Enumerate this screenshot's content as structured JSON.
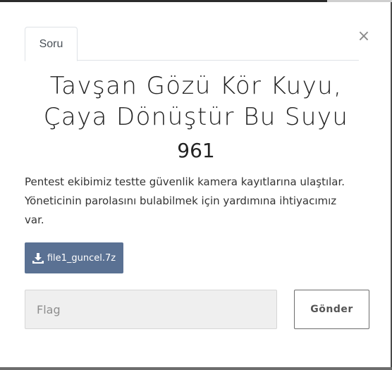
{
  "modal": {
    "tab_label": "Soru",
    "close_symbol": "×",
    "title_line1": "Tavşan Gözü Kör Kuyu,",
    "title_line2": "Çaya Dönüştür Bu Suyu",
    "points": "961",
    "description_line1": "Pentest ekibimiz testte güvenlik kamera kayıtlarına ulaştılar.",
    "description_line2": "Yöneticinin parolasını bulabilmek için yardımına ihtiyacımız",
    "description_line3": "var.",
    "download": {
      "label": "file1_guncel.7z",
      "icon": "download-icon"
    },
    "flag_input": {
      "placeholder": "Flag",
      "value": ""
    },
    "submit_label": "Gönder"
  },
  "colors": {
    "download_button": "#5a7193",
    "input_background": "#efefef",
    "submit_border": "#6c6c6c"
  }
}
